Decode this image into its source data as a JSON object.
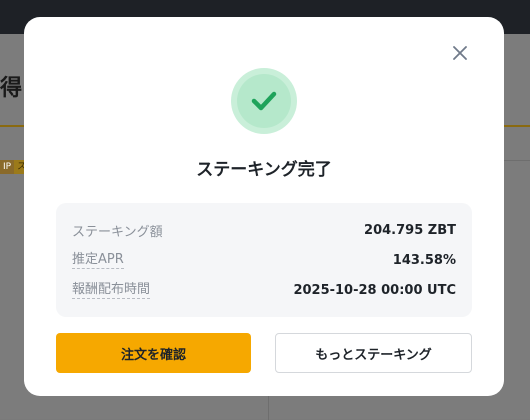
{
  "background": {
    "title_fragment": "得",
    "badge_a": "IP",
    "badge_b": "ス"
  },
  "modal": {
    "close_icon": "close-icon",
    "success_icon": "check-icon",
    "title": "ステーキング完了",
    "rows": [
      {
        "label": "ステーキング額",
        "value": "204.795 ZBT"
      },
      {
        "label": "推定APR",
        "value": "143.58%"
      },
      {
        "label": "報酬配布時間",
        "value": "2025-10-28 00:00 UTC"
      }
    ],
    "primary_button": "注文を確認",
    "secondary_button": "もっとステーキング"
  },
  "colors": {
    "accent": "#f6a800",
    "success": "#1fa35b",
    "success_bg": "#c9efd9"
  }
}
